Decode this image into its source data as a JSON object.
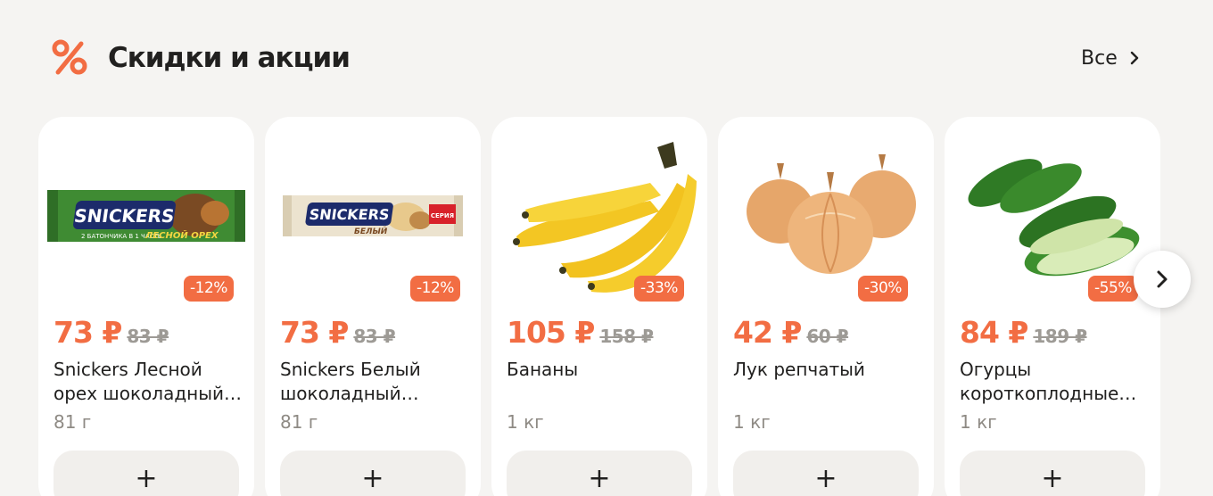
{
  "section": {
    "title": "Скидки и акции",
    "icon": "percent-icon",
    "see_all_label": "Все",
    "accent": "#f26d43"
  },
  "products": [
    {
      "discount": "-12%",
      "price": "73 ₽",
      "old_price": "83 ₽",
      "name": "Snickers Лесной орех шоколадный…",
      "weight": "81 г",
      "image": "snickers-hazelnut-bar",
      "add_label": "+"
    },
    {
      "discount": "-12%",
      "price": "73 ₽",
      "old_price": "83 ₽",
      "name": "Snickers Белый шоколадный…",
      "weight": "81 г",
      "image": "snickers-white-bar",
      "add_label": "+"
    },
    {
      "discount": "-33%",
      "price": "105 ₽",
      "old_price": "158 ₽",
      "name": "Бананы",
      "weight": "1 кг",
      "image": "bananas",
      "add_label": "+"
    },
    {
      "discount": "-30%",
      "price": "42 ₽",
      "old_price": "60 ₽",
      "name": "Лук репчатый",
      "weight": "1 кг",
      "image": "onions",
      "add_label": "+"
    },
    {
      "discount": "-55%",
      "price": "84 ₽",
      "old_price": "189 ₽",
      "name": "Огурцы короткоплодные…",
      "weight": "1 кг",
      "image": "cucumbers",
      "add_label": "+"
    }
  ],
  "images": {
    "snickers_label": "SNICKERS",
    "snickers_hazelnut_sub": "ЛЕСНОЙ ОРЕХ",
    "snickers_hazelnut_pack": "2 БАТОНЧИКА В 1 ЧАСТЬ",
    "snickers_white_sub": "БЕЛЫЙ",
    "snickers_white_tag": "СЕРИЯ"
  }
}
